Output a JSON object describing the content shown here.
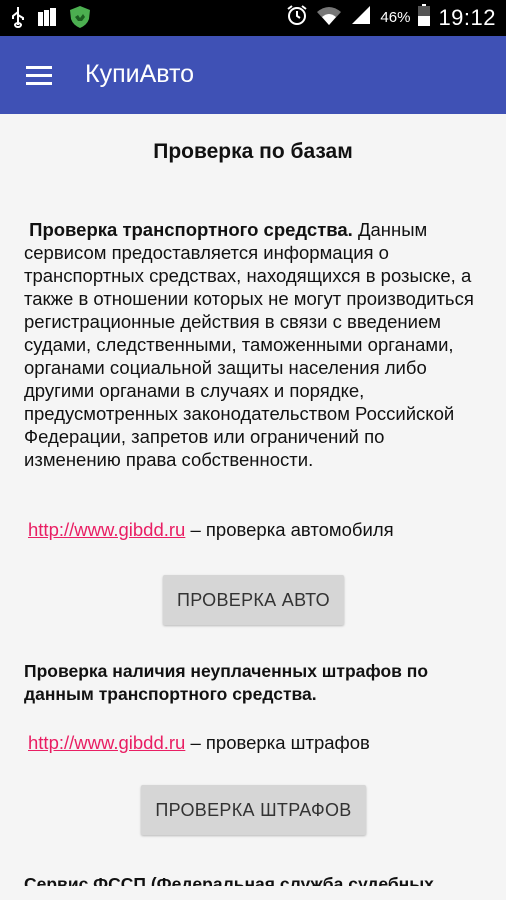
{
  "status_bar": {
    "battery_percent": "46%",
    "time": "19:12",
    "icons": [
      "usb-icon",
      "storage-icon",
      "shield-app-icon",
      "alarm-icon",
      "wifi-icon",
      "signal-icon",
      "battery-icon"
    ]
  },
  "app_bar": {
    "title": "КупиАвто",
    "menu_icon": "hamburger-menu-icon",
    "color": "#3f51b5"
  },
  "page": {
    "title": "Проверка по базам",
    "vehicle_section": {
      "bold_lead": "Проверка транспортного средства.",
      "text": " Данным сервисом предоставляется информация о транспортных средствах, находящихся в розыске, а также в отношении которых не могут производиться регистрационные действия в связи с введением судами, следственными, таможенными органами, органами социальной защиты населения либо другими органами в случаях и порядке, предусмотренных законодательством Российской Федерации, запретов или ограничений по изменению права собственности.",
      "link_text": "http://www.gibdd.ru",
      "link_suffix": " – проверка автомобиля",
      "button_label": "ПРОВЕРКА АВТО"
    },
    "fines_section": {
      "heading": "Проверка наличия неуплаченных штрафов по данным транспортного средства.",
      "link_text": "http://www.gibdd.ru",
      "link_suffix": " – проверка штрафов",
      "button_label": "ПРОВЕРКА ШТРАФОВ"
    },
    "cutoff_text": "Сервис ФССП (Федеральная служба судебных"
  },
  "colors": {
    "link": "#e91e63",
    "button_bg": "#d6d6d6",
    "background": "#f5f5f5"
  }
}
